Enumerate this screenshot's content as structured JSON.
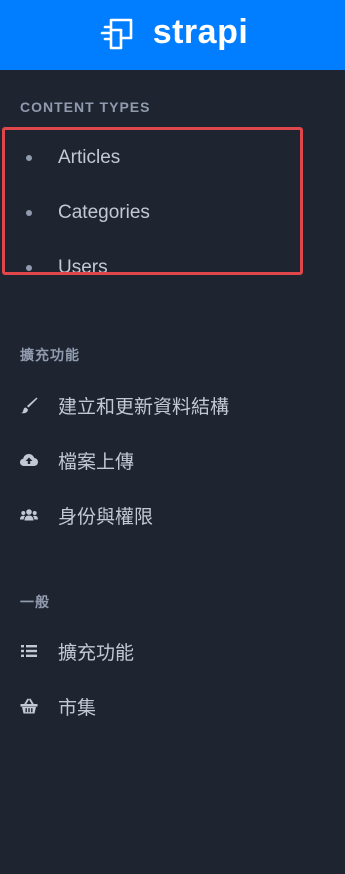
{
  "brand": {
    "logo_icon": "strapi-logo-icon",
    "name": "strapi",
    "bar_color": "#007eff"
  },
  "content_types": {
    "title": "CONTENT TYPES",
    "items": [
      {
        "label": "Articles"
      },
      {
        "label": "Categories"
      },
      {
        "label": "Users"
      }
    ],
    "highlight_color": "#e0474a"
  },
  "plugins": {
    "title": "擴充功能",
    "items": [
      {
        "label": "建立和更新資料結構",
        "icon": "paint-brush-icon"
      },
      {
        "label": "檔案上傳",
        "icon": "cloud-upload-icon"
      },
      {
        "label": "身份與權限",
        "icon": "users-icon"
      }
    ]
  },
  "general": {
    "title": "一般",
    "items": [
      {
        "label": "擴充功能",
        "icon": "list-icon"
      },
      {
        "label": "市集",
        "icon": "basket-icon"
      }
    ]
  },
  "colors": {
    "background": "#1e2430",
    "text": "#c3c8d3",
    "muted": "#919bae"
  }
}
